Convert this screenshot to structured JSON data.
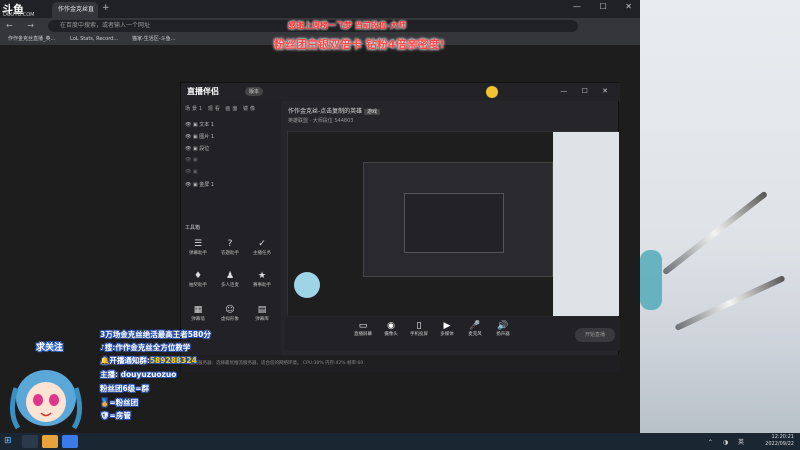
{
  "browser": {
    "logo": "斗鱼",
    "logo_sub": "DOUYU.COM",
    "tab_label": "作作金克丝直播_英...",
    "new_tab": "+",
    "window_controls": "— ☐ ✕",
    "nav_icons": "← → ⟳",
    "url_placeholder": "在百度中搜索，或者输入一个网址",
    "bookmarks": [
      "作作金克丝直播_英...",
      "LoL Stats, Record...",
      "猫家-生活区-斗鱼..."
    ]
  },
  "overlay": {
    "banner_line1": "感谢上周榜一飞梦   当前段位-大师",
    "banner_line2": "粉丝团白银双倍卡 钻粉4倍亲密度!",
    "follow_label": "求关注",
    "lines": [
      {
        "prefix": "",
        "text": "3万场金克丝绝活最高王者580分"
      },
      {
        "prefix": "",
        "text": "搜:作作金克丝全方位教学"
      },
      {
        "prefix": "",
        "text": "开播通知群:",
        "highlight": "589288324"
      },
      {
        "prefix": "",
        "text": "主播",
        "highlight": ": douyuzuozuo"
      },
      {
        "prefix": "",
        "text": "粉丝团6级=",
        "highlight": "群"
      },
      {
        "prefix": "",
        "text": "=粉丝团"
      },
      {
        "prefix": "",
        "text": "=房管"
      }
    ]
  },
  "app": {
    "logo": "直播伴侣",
    "version": "版本",
    "window_controls": "— ☐ ✕",
    "scene_tabs": "场景1 观看 画面 镜像",
    "sources": [
      "文本 1",
      "图片 1",
      "段位",
      "",
      "",
      "金屏 1"
    ],
    "tools_heading": "工具箱",
    "tools": [
      "弹幕助手",
      "答题助手",
      "主播任务",
      "抽奖助手",
      "多人连麦",
      "赛事助手",
      "弹幕墙",
      "虚拟形象",
      "弹幕库"
    ],
    "game_title": "作作金克丝-点击复制的英雄",
    "game_tag": "游戏",
    "game_category": "英雄联盟 · 大师段位  544803",
    "bottom_buttons": [
      "直播屏幕",
      "摄像头",
      "手机投屏",
      "多媒体",
      "麦克风",
      "扬声器"
    ],
    "live_button": "开始直播",
    "status_text": "推流服务器：选择最优推流服务器，适合您的网络环境。    CPU:30%   内存:42%   帧率:60"
  },
  "taskbar": {
    "start_icon": "⊞",
    "tray_icons": "⌃ ◑ 英 ",
    "time": "12:20:21",
    "date": "2022/09/22"
  }
}
